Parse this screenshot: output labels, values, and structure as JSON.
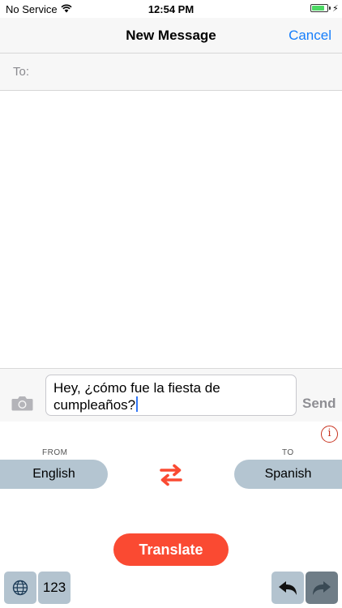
{
  "status_bar": {
    "carrier": "No Service",
    "time": "12:54 PM",
    "battery_level": 0.85,
    "battery_color": "#4cd964"
  },
  "nav": {
    "title": "New Message",
    "cancel_label": "Cancel",
    "accent": "#157efb"
  },
  "recipient": {
    "label": "To:"
  },
  "compose": {
    "message": "Hey, ¿cómo fue la fiesta de cumpleaños?",
    "send_label": "Send"
  },
  "translator": {
    "from_label": "FROM",
    "to_label": "TO",
    "from_language": "English",
    "to_language": "Spanish",
    "translate_label": "Translate",
    "accent": "#fa4a32",
    "pill_color": "#b4c5d1",
    "info_color": "#c8321e"
  },
  "keyboard_bar": {
    "numbers_label": "123",
    "key_color": "#b3c3cf",
    "dark_key_color": "#6f7d87"
  }
}
